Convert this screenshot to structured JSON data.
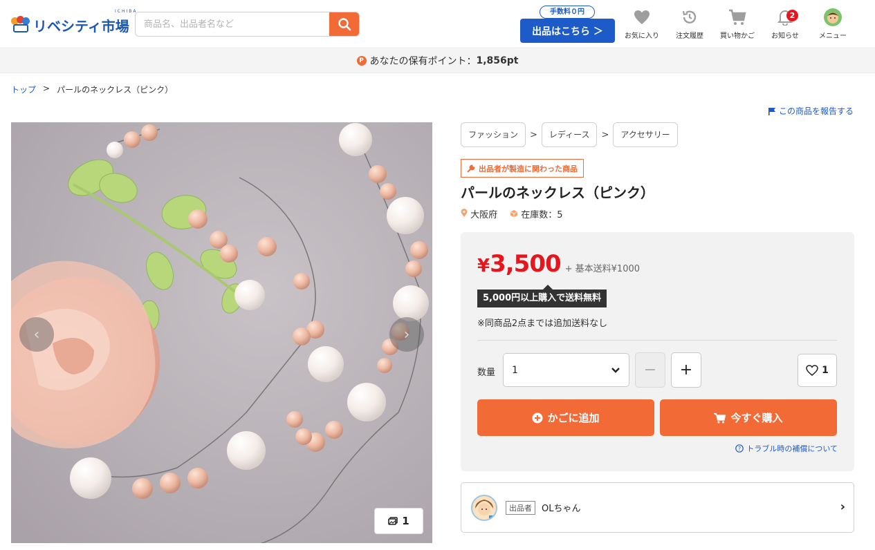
{
  "header": {
    "logo_text": "リベシティ市場",
    "logo_sub": "ICHIBA",
    "search_placeholder": "商品名、出品者名など",
    "sell_badge": "手数料０円",
    "sell_button": "出品はこちら ＞",
    "nav": [
      {
        "label": "お気に入り",
        "icon": "heart-icon"
      },
      {
        "label": "注文履歴",
        "icon": "history-icon"
      },
      {
        "label": "買い物かご",
        "icon": "cart-icon"
      },
      {
        "label": "お知らせ",
        "icon": "bell-icon",
        "badge": "2"
      },
      {
        "label": "メニュー",
        "icon": "avatar-icon"
      }
    ],
    "colors": {
      "brand": "#1d5bc9",
      "accent": "#f26a35"
    }
  },
  "points": {
    "icon": "P",
    "label": "あなたの保有ポイント：",
    "value": "1,856pt"
  },
  "breadcrumb": {
    "home": "トップ",
    "separator": ">",
    "current": "パールのネックレス（ピンク）"
  },
  "report_link": "この商品を報告する",
  "gallery": {
    "image_count": "1",
    "prev_icon": "chevron-left-icon",
    "next_icon": "chevron-right-icon"
  },
  "product": {
    "categories": [
      "ファッション",
      "レディース",
      "アクセサリー"
    ],
    "category_separator": ">",
    "maker_badge": "出品者が製造に関わった商品",
    "title": "パールのネックレス（ピンク）",
    "location": "大阪府",
    "stock": "在庫数：5"
  },
  "purchase": {
    "currency": "¥",
    "price": "3,500",
    "shipping": "+ 基本送料¥1000",
    "free_shipping_tip": "5,000円以上購入で送料無料",
    "note": "※同商品2点までは追加送料なし",
    "qty_label": "数量",
    "qty_value": "1",
    "minus": "−",
    "plus": "+",
    "favorite_count": "1",
    "add_to_cart": "かごに追加",
    "buy_now": "今すぐ購入",
    "trouble_link": "トラブル時の補償について"
  },
  "seller": {
    "tag": "出品者",
    "name": "OLちゃん"
  }
}
